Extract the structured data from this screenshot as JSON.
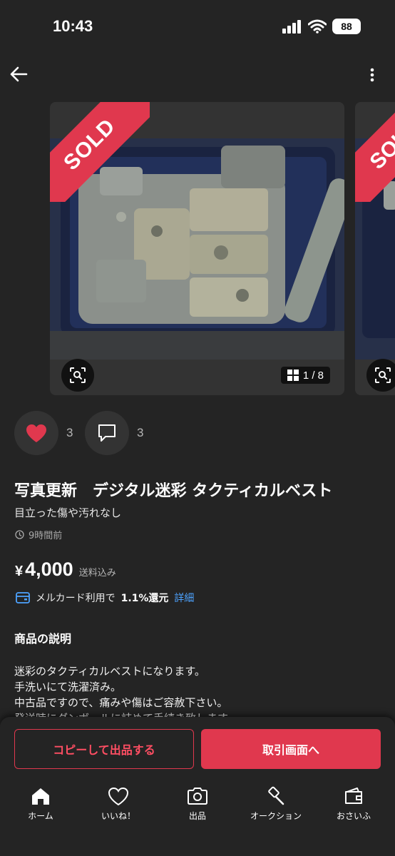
{
  "status_bar": {
    "time": "10:43",
    "battery": "88"
  },
  "carousel": {
    "sold_label": "SOLD",
    "counter": "1 / 8"
  },
  "actions": {
    "like_count": "3",
    "comment_count": "3"
  },
  "item": {
    "title": "写真更新　デジタル迷彩 タクティカルベスト",
    "condition": "目立った傷や汚れなし",
    "posted": "9時間前",
    "currency": "¥",
    "price": "4,000",
    "shipping": "送料込み"
  },
  "merucard": {
    "prefix": "メルカード利用で",
    "rate": "1.1%還元",
    "link": "詳細"
  },
  "description": {
    "heading": "商品の説明",
    "lines": [
      "迷彩のタクティカルベストになります。",
      "手洗いにて洗濯済み。",
      "中古品ですので、痛みや傷はご容赦下さい。",
      "発送時にダンボールに詰めて手続き致します。"
    ]
  },
  "buttons": {
    "copy": "コピーして出品する",
    "trade": "取引画面へ"
  },
  "tabs": [
    {
      "label": "ホーム",
      "icon": "home-icon"
    },
    {
      "label": "いいね！",
      "icon": "heart-icon"
    },
    {
      "label": "出品",
      "icon": "camera-icon"
    },
    {
      "label": "オークション",
      "icon": "gavel-icon"
    },
    {
      "label": "おさいふ",
      "icon": "wallet-icon"
    }
  ],
  "colors": {
    "accent": "#e0384e",
    "link": "#4da3ff",
    "background": "#242424"
  }
}
